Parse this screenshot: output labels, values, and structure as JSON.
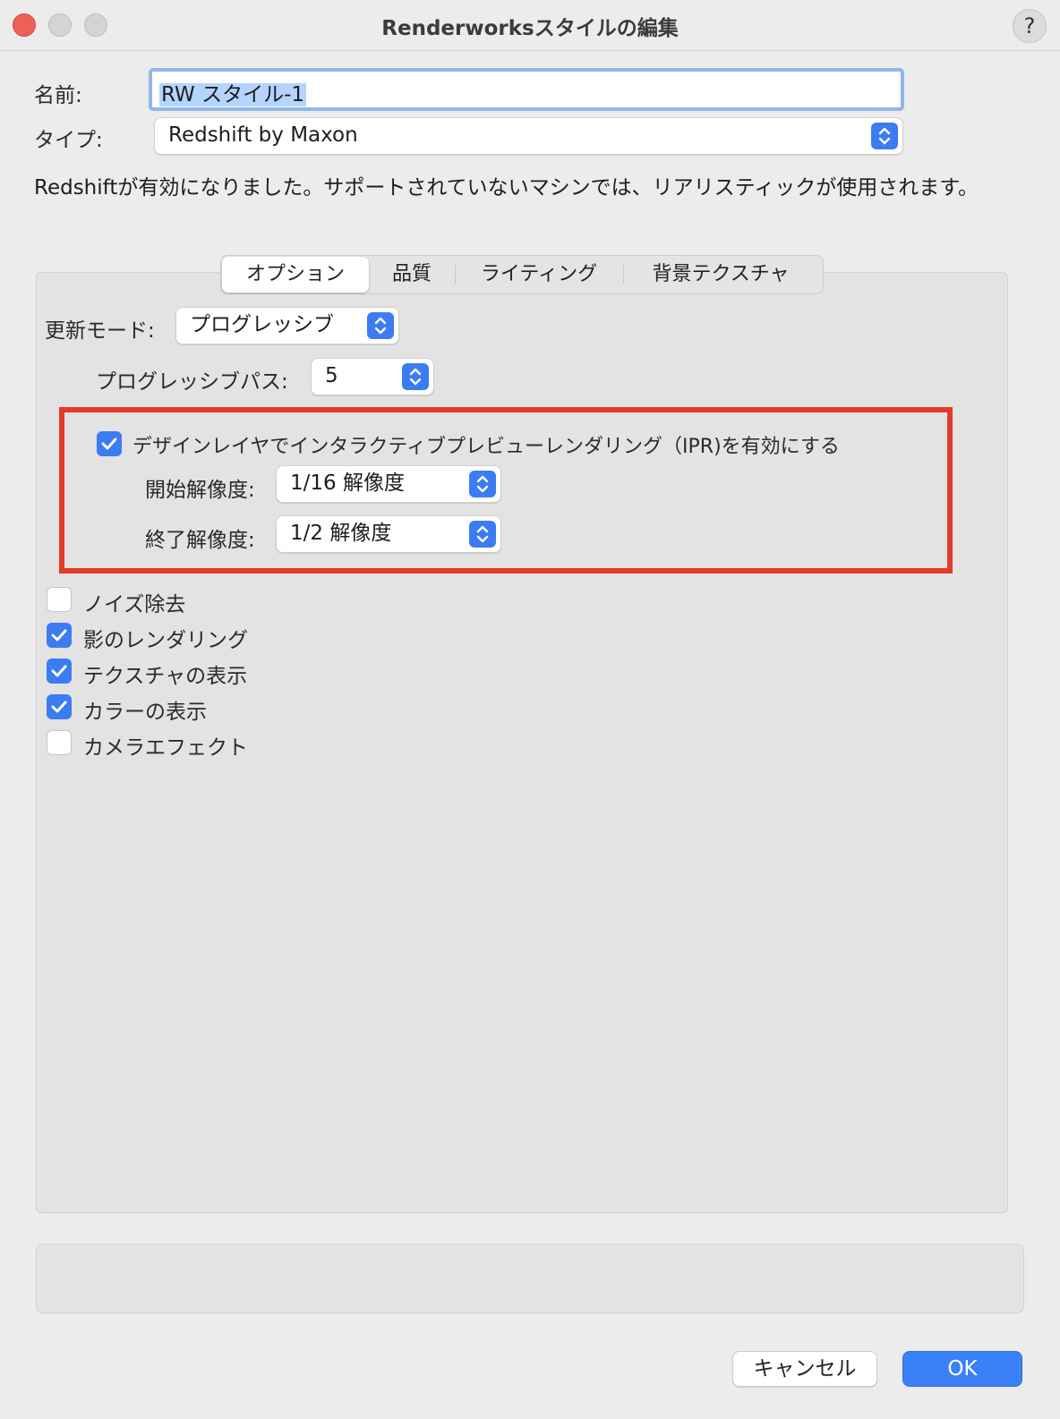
{
  "window": {
    "title": "Renderworksスタイルの編集",
    "help": "?"
  },
  "form": {
    "name_label": "名前:",
    "name_value": "RW スタイル-1",
    "type_label": "タイプ:",
    "type_value": "Redshift by Maxon",
    "info_text": "Redshiftが有効になりました。サポートされていないマシンでは、リアリスティックが使用されます。"
  },
  "tabs": [
    {
      "label": "オプション",
      "active": true
    },
    {
      "label": "品質",
      "active": false
    },
    {
      "label": "ライティング",
      "active": false
    },
    {
      "label": "背景テクスチャ",
      "active": false
    }
  ],
  "options": {
    "update_mode_label": "更新モード:",
    "update_mode_value": "プログレッシブ",
    "progressive_pass_label": "プログレッシブパス:",
    "progressive_pass_value": "5",
    "ipr_label": "デザインレイヤでインタラクティブプレビューレンダリング（IPR)を有効にする",
    "ipr_checked": true,
    "start_res_label": "開始解像度:",
    "start_res_value": "1/16 解像度",
    "end_res_label": "終了解像度:",
    "end_res_value": "1/2 解像度",
    "checkboxes": [
      {
        "label": "ノイズ除去",
        "checked": false
      },
      {
        "label": "影のレンダリング",
        "checked": true
      },
      {
        "label": "テクスチャの表示",
        "checked": true
      },
      {
        "label": "カラーの表示",
        "checked": true
      },
      {
        "label": "カメラエフェクト",
        "checked": false
      }
    ]
  },
  "buttons": {
    "cancel": "キャンセル",
    "ok": "OK"
  },
  "colors": {
    "accent": "#3c7cf2",
    "highlight_box": "#e43a29"
  }
}
